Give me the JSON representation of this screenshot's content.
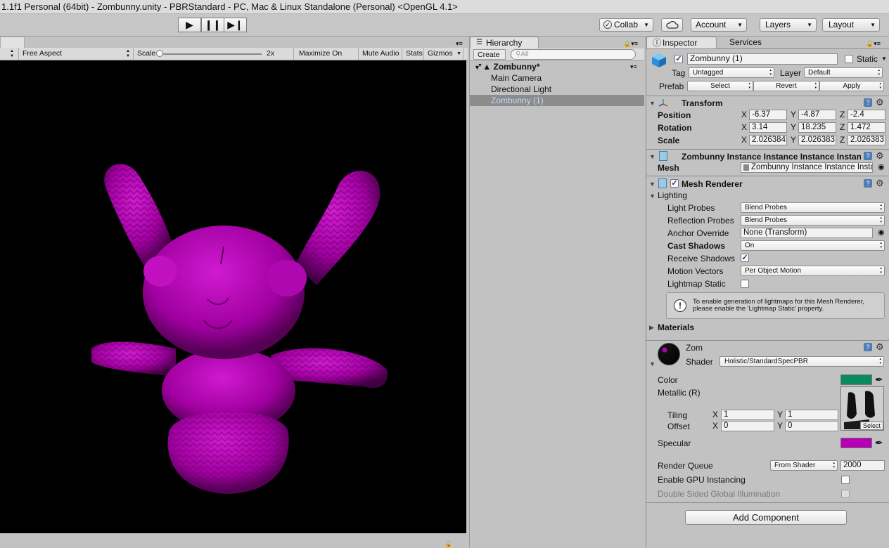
{
  "window_title": "1.1f1 Personal (64bit) - Zombunny.unity - PBRStandard - PC, Mac & Linux Standalone (Personal) <OpenGL 4.1>",
  "toolbar": {
    "collab": "Collab",
    "account": "Account",
    "layers": "Layers",
    "layout": "Layout"
  },
  "game_view": {
    "aspect": "Free Aspect",
    "scale_label": "Scale",
    "scale_value": "2x",
    "maximize": "Maximize On Play",
    "mute": "Mute Audio",
    "stats": "Stats",
    "gizmos": "Gizmos"
  },
  "hierarchy": {
    "tab": "Hierarchy",
    "create": "Create",
    "search_placeholder": "All",
    "scene": "Zombunny*",
    "items": [
      "Main Camera",
      "Directional Light",
      "Zombunny (1)"
    ]
  },
  "inspector": {
    "tab": "Inspector",
    "tab2": "Services",
    "object_name": "Zombunny (1)",
    "static_label": "Static",
    "tag_label": "Tag",
    "tag_value": "Untagged",
    "layer_label": "Layer",
    "layer_value": "Default",
    "prefab_label": "Prefab",
    "prefab_select": "Select",
    "prefab_revert": "Revert",
    "prefab_apply": "Apply",
    "transform": {
      "title": "Transform",
      "position_label": "Position",
      "rotation_label": "Rotation",
      "scale_label": "Scale",
      "position": [
        "-6.37",
        "-4.87",
        "-2.4"
      ],
      "rotation": [
        "3.14",
        "18.235",
        "1.472"
      ],
      "scale": [
        "2.026384",
        "2.026383",
        "2.026383"
      ],
      "x": "X",
      "y": "Y",
      "z": "Z"
    },
    "mesh_filter": {
      "title": "Zombunny Instance Instance Instance Instance",
      "mesh_label": "Mesh",
      "mesh_value": "Zombunny Instance Instance Instance Instance"
    },
    "mesh_renderer": {
      "title": "Mesh Renderer",
      "lighting": "Lighting",
      "light_probes_label": "Light Probes",
      "light_probes_value": "Blend Probes",
      "reflection_probes_label": "Reflection Probes",
      "reflection_probes_value": "Blend Probes",
      "anchor_override_label": "Anchor Override",
      "anchor_override_value": "None (Transform)",
      "cast_shadows_label": "Cast Shadows",
      "cast_shadows_value": "On",
      "receive_shadows_label": "Receive Shadows",
      "motion_vectors_label": "Motion Vectors",
      "motion_vectors_value": "Per Object Motion",
      "lightmap_static_label": "Lightmap Static",
      "info": "To enable generation of lightmaps for this Mesh Renderer, please enable the 'Lightmap Static' property.",
      "materials": "Materials"
    },
    "material": {
      "name": "Zom",
      "shader_label": "Shader",
      "shader_value": "Holistic/StandardSpecPBR",
      "color_label": "Color",
      "color_value": "#0a8a5e",
      "metallic_label": "Metallic (R)",
      "tiling_label": "Tiling",
      "offset_label": "Offset",
      "tiling": [
        "1",
        "1"
      ],
      "offset": [
        "0",
        "0"
      ],
      "texture_select": "Select",
      "specular_label": "Specular",
      "specular_value": "#b400b4",
      "render_queue_label": "Render Queue",
      "render_queue_mode": "From Shader",
      "render_queue_value": "2000",
      "gpu_instancing_label": "Enable GPU Instancing",
      "double_sided_label": "Double Sided Global Illumination"
    },
    "add_component": "Add Component"
  },
  "colors": {
    "selection": "#8c8c8c",
    "bunny": "#b400b4",
    "viewport_bg": "#000000"
  }
}
